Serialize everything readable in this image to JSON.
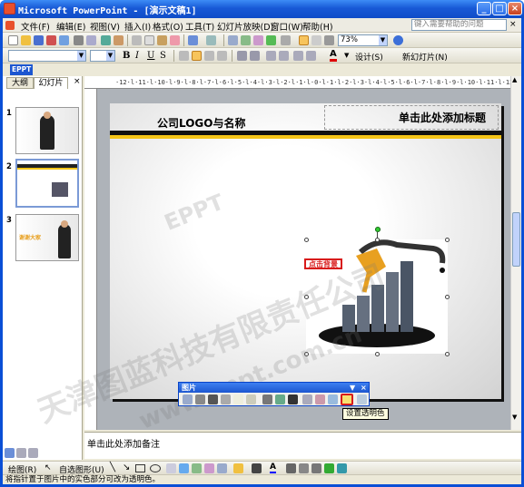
{
  "window": {
    "title": "Microsoft PowerPoint - [演示文稿1]",
    "min": "_",
    "max": "□",
    "close": "×"
  },
  "menu": {
    "items": [
      "文件(F)",
      "编辑(E)",
      "视图(V)",
      "插入(I)",
      "格式(O)",
      "工具(T)",
      "幻灯片放映(D)",
      "窗口(W)",
      "帮助(H)"
    ],
    "help_placeholder": "键入需要帮助的问题"
  },
  "toolbar": {
    "zoom": "73%",
    "design_label": "设计(S)",
    "new_slide_label": "新幻灯片(N)",
    "eppt_label": "EPPT"
  },
  "left_pane": {
    "tab_outline": "大纲",
    "tab_slides": "幻灯片",
    "close": "×",
    "slides": [
      {
        "num": "1"
      },
      {
        "num": "2"
      },
      {
        "num": "3"
      }
    ],
    "thumb3_text": "谢谢大家"
  },
  "ruler": {
    "h": "·12·l·11·l·10·l·9·l·8·l·7·l·6·l·5·l·4·l·3·l·2·l·1·l·0·l·1·l·2·l·3·l·4·l·5·l·6·l·7·l·8·l·9·l·10·l·11·l·12·"
  },
  "slide": {
    "logo_text": "公司LOGO与名称",
    "title_placeholder": "单击此处添加标题",
    "callout": "点击背景",
    "accent": "#f5c518",
    "callout_color": "#d81b1b"
  },
  "picture_toolbar": {
    "title": "图片",
    "tooltip": "设置透明色"
  },
  "notes": {
    "placeholder": "单击此处添加备注"
  },
  "drawbar": {
    "draw_label": "绘图(R)",
    "autoshape_label": "自选图形(U)"
  },
  "status": {
    "text": "将指针置于图片中的实色部分可改为透明色。"
  },
  "watermark": {
    "line1": "EPPT",
    "line2": "天津图蓝科技有限责任公司",
    "line3": "www.eppt.com.cn"
  }
}
